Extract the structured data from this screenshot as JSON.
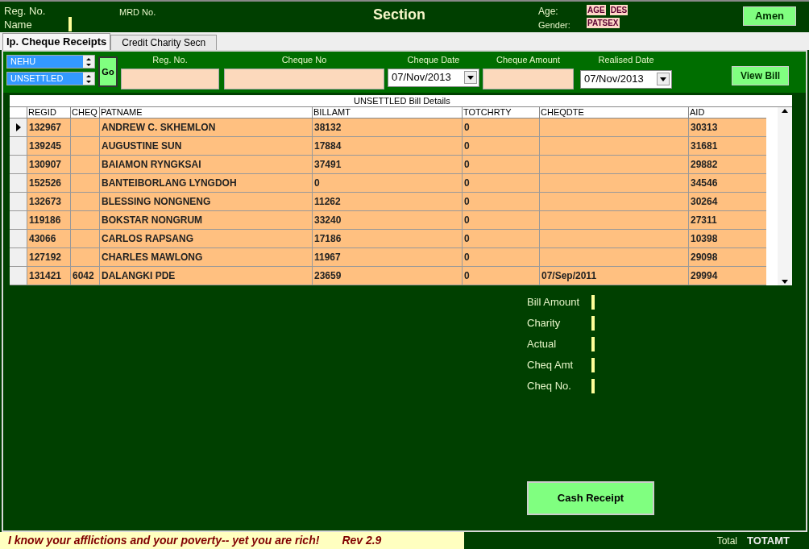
{
  "header": {
    "reg_no_label": "Reg. No.",
    "name_label": "Name",
    "mrd_label": "MRD No.",
    "title": "Section",
    "age_label": "Age:",
    "gender_label": "Gender:",
    "age_value": "AGE",
    "des_value": "DES",
    "sex_value": "PATSEX",
    "amen_button": "Amen"
  },
  "tabs": [
    {
      "label": "Ip. Cheque Receipts",
      "selected": true
    },
    {
      "label": "Credit Charity Secn",
      "selected": false
    }
  ],
  "filters": {
    "combo_1": "NEHU",
    "combo_2": "UNSETTLED",
    "go_button": "Go",
    "reg_no_label": "Reg. No.",
    "cheque_no_label": "Cheque No",
    "cheque_date_label": "Cheque Date",
    "cheque_date_value": "07/Nov/2013",
    "cheque_amount_label": "Cheque Amount",
    "realised_date_label": "Realised Date",
    "realised_date_value": "07/Nov/2013",
    "view_bill_button": "View Bill"
  },
  "grid": {
    "caption": "UNSETTLED Bill Details",
    "columns": [
      "REGID",
      "CHEQ",
      "PATNAME",
      "BILLAMT",
      "TOTCHRTY",
      "CHEQDTE",
      "AID"
    ],
    "rows": [
      {
        "selected": true,
        "cells": [
          "132967",
          "",
          "ANDREW C. SKHEMLON",
          "38132",
          "0",
          "",
          "30313"
        ]
      },
      {
        "selected": false,
        "cells": [
          "139245",
          "",
          "AUGUSTINE SUN",
          "17884",
          "0",
          "",
          "31681"
        ]
      },
      {
        "selected": false,
        "cells": [
          "130907",
          "",
          "BAIAMON RYNGKSAI",
          "37491",
          "0",
          "",
          "29882"
        ]
      },
      {
        "selected": false,
        "cells": [
          "152526",
          "",
          "BANTEIBORLANG LYNGDOH",
          "0",
          "0",
          "",
          "34546"
        ]
      },
      {
        "selected": false,
        "cells": [
          "132673",
          "",
          "BLESSING NONGNENG",
          "11262",
          "0",
          "",
          "30264"
        ]
      },
      {
        "selected": false,
        "cells": [
          "119186",
          "",
          "BOKSTAR NONGRUM",
          "33240",
          "0",
          "",
          "27311"
        ]
      },
      {
        "selected": false,
        "cells": [
          "43066",
          "",
          "CARLOS RAPSANG",
          "17186",
          "0",
          "",
          "10398"
        ]
      },
      {
        "selected": false,
        "cells": [
          "127192",
          "",
          "CHARLES MAWLONG",
          "11967",
          "0",
          "",
          "29098"
        ]
      },
      {
        "selected": false,
        "cells": [
          "131421",
          "6042",
          "DALANGKI PDE",
          "23659",
          "0",
          "07/Sep/2011",
          "29994"
        ]
      }
    ]
  },
  "summary": [
    "Bill Amount",
    "Charity",
    "Actual",
    "Cheq Amt",
    "Cheq No."
  ],
  "cash_receipt_button": "Cash Receipt",
  "footer": {
    "quote": "I know your afflictions and your poverty-- yet you are rich!",
    "reference": "Rev 2.9",
    "total_label": "Total",
    "total_value": "TOTAMT"
  }
}
